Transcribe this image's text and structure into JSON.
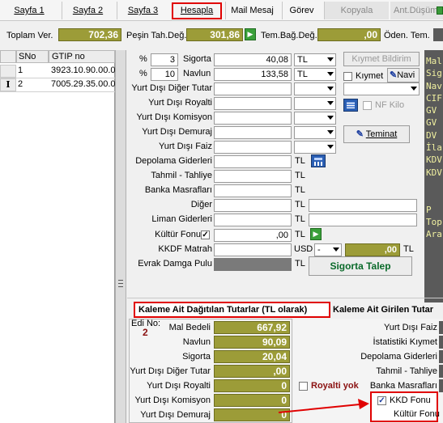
{
  "tabs": [
    {
      "label": "Sayfa 1"
    },
    {
      "label": "Sayfa 2"
    },
    {
      "label": "Sayfa 3"
    },
    {
      "label": "Hesapla"
    },
    {
      "label": "Mail Mesaj"
    },
    {
      "label": "Görev"
    },
    {
      "label": "Kopyala"
    },
    {
      "label": "Ant.Düşüm"
    }
  ],
  "totals": {
    "toplam_ver_label": "Toplam Ver.",
    "toplam_ver_value": "702,36",
    "pesin_label": "Peşin Tah.Değ.",
    "pesin_value": "301,86",
    "tem_label": "Tem.Bağ.Değ.",
    "tem_value": ",00",
    "oden_label": "Öden. Tem."
  },
  "grid": {
    "headers": [
      "SNo",
      "GTIP no"
    ],
    "rows": [
      {
        "sno": "1",
        "gtip": "3923.10.90.00.0"
      },
      {
        "sno": "2",
        "gtip": "7005.29.35.00.0"
      }
    ]
  },
  "form": {
    "sigorta": {
      "pct_sign": "%",
      "pct": "3",
      "label": "Sigorta",
      "value": "40,08",
      "currency": "TL"
    },
    "navlun": {
      "pct_sign": "%",
      "pct": "10",
      "label": "Navlun",
      "value": "133,58",
      "currency": "TL"
    },
    "yurt_disi_diger_tutar": "Yurt Dışı Diğer Tutar",
    "yurt_disi_royalti": "Yurt Dışı Royalti",
    "yurt_disi_komisyon": "Yurt Dışı Komisyon",
    "yurt_disi_demuraj": "Yurt Dışı Demuraj",
    "yurt_disi_faiz": "Yurt Dışı Faiz",
    "depolama": {
      "label": "Depolama Giderleri",
      "currency": "TL"
    },
    "tahmil": {
      "label": "Tahmil - Tahliye",
      "currency": "TL"
    },
    "banka": {
      "label": "Banka Masrafları",
      "currency": "TL"
    },
    "diger": {
      "label": "Diğer",
      "currency": "TL"
    },
    "liman": {
      "label": "Liman Giderleri",
      "currency": "TL"
    },
    "kultur": {
      "label": "Kültür Fonu",
      "value": ",00",
      "currency": "TL"
    },
    "kkdf": {
      "label": "KKDF Matrah",
      "currency": "USD",
      "currency2": "-",
      "value": ",00",
      "currency3": "TL"
    },
    "evrak": {
      "label": "Evrak Damga Pulu",
      "currency": "TL"
    }
  },
  "side": {
    "kiymet_bildirim": "Kıymet Bildirim",
    "kiymet": "Kıymet",
    "navi": "Navi",
    "nf_kilo": "NF Kilo",
    "teminat": "Teminat",
    "sigorta_talep": "Sigorta Talep"
  },
  "right_panel_text": "Mal\nSig\nNav\nCIF\nGV\nGV\nDV\nİla\nKDV\nKDV\n\n\nP\nTop\nAra",
  "bottom_tabs": {
    "active": "Kaleme Ait Dağıtılan Tutarlar (TL olarak)",
    "other": "Kaleme Ait Girilen Tutar"
  },
  "bottom": {
    "edi_no_label": "Edi No:",
    "edi_no_value": "2",
    "left_rows": [
      {
        "label": "Mal Bedeli",
        "value": "667,92"
      },
      {
        "label": "Navlun",
        "value": "90,09"
      },
      {
        "label": "Sigorta",
        "value": "20,04"
      },
      {
        "label": "Yurt Dışı Diğer Tutar",
        "value": ",00"
      },
      {
        "label": "Yurt Dışı Royalti",
        "value": "0"
      },
      {
        "label": "Yurt Dışı Komisyon",
        "value": "0"
      },
      {
        "label": "Yurt Dışı Demuraj",
        "value": "0"
      }
    ],
    "right_rows": [
      {
        "label": "Yurt Dışı Faiz"
      },
      {
        "label": "İstatistiki Kıymet"
      },
      {
        "label": "Depolama Giderleri"
      },
      {
        "label": "Tahmil - Tahliye"
      },
      {
        "label": "Banka Masrafları"
      }
    ],
    "royalti_yok": "Royalti yok",
    "kkd_fonu": "KKD Fonu",
    "kultur_fonu": "Kültür Fonu"
  },
  "colors": {
    "olive": "#9c9c38",
    "dark_panel": "#5a5a5a",
    "annotation_red": "#e00000",
    "accent_blue": "#1e3fa0"
  }
}
